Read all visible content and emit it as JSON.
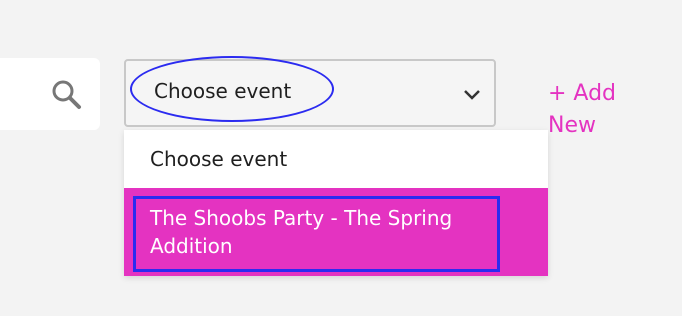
{
  "search": {
    "icon": "search-icon"
  },
  "event_select": {
    "selected_label": "Choose event",
    "chevron_icon": "chevron-down-icon",
    "options": [
      {
        "label": "Choose event",
        "highlighted": false
      },
      {
        "label": "The Shoobs Party - The Spring Addition",
        "highlighted": true
      }
    ]
  },
  "add_new": {
    "label": "+ Add New"
  },
  "colors": {
    "accent": "#e433c1",
    "annotation": "#2b2bf0",
    "background": "#f3f3f3"
  }
}
